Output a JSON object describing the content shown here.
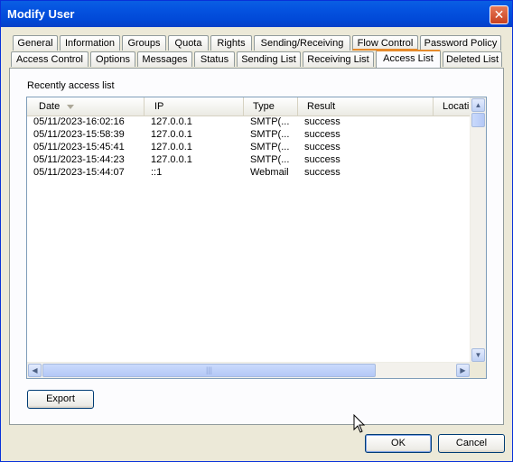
{
  "window": {
    "title": "Modify User",
    "close_glyph": "✕"
  },
  "tabs_back": [
    "General",
    "Information",
    "Groups",
    "Quota",
    "Rights",
    "Sending/Receiving",
    "Flow Control",
    "Password Policy"
  ],
  "tabs_front": [
    "Access Control",
    "Options",
    "Messages",
    "Status",
    "Sending List",
    "Receiving List",
    "Access List",
    "Deleted List"
  ],
  "active_tab": "Access List",
  "panel": {
    "group_label": "Recently access list",
    "columns": [
      "Date",
      "IP",
      "Type",
      "Result",
      "Locati"
    ],
    "rows": [
      [
        "05/11/2023-16:02:16",
        "127.0.0.1",
        "SMTP(...",
        "success"
      ],
      [
        "05/11/2023-15:58:39",
        "127.0.0.1",
        "SMTP(...",
        "success"
      ],
      [
        "05/11/2023-15:45:41",
        "127.0.0.1",
        "SMTP(...",
        "success"
      ],
      [
        "05/11/2023-15:44:23",
        "127.0.0.1",
        "SMTP(...",
        "success"
      ],
      [
        "05/11/2023-15:44:07",
        "::1",
        "Webmail",
        "success"
      ]
    ],
    "export_label": "Export"
  },
  "footer": {
    "ok_label": "OK",
    "cancel_label": "Cancel"
  },
  "colors": {
    "title_bar": "#0554E0",
    "active_tab_accent": "#E68B2C",
    "dialog_bg": "#ECE9D8"
  },
  "icons": {
    "sort": "sort-down-icon",
    "cursor": "mouse-pointer-icon"
  }
}
